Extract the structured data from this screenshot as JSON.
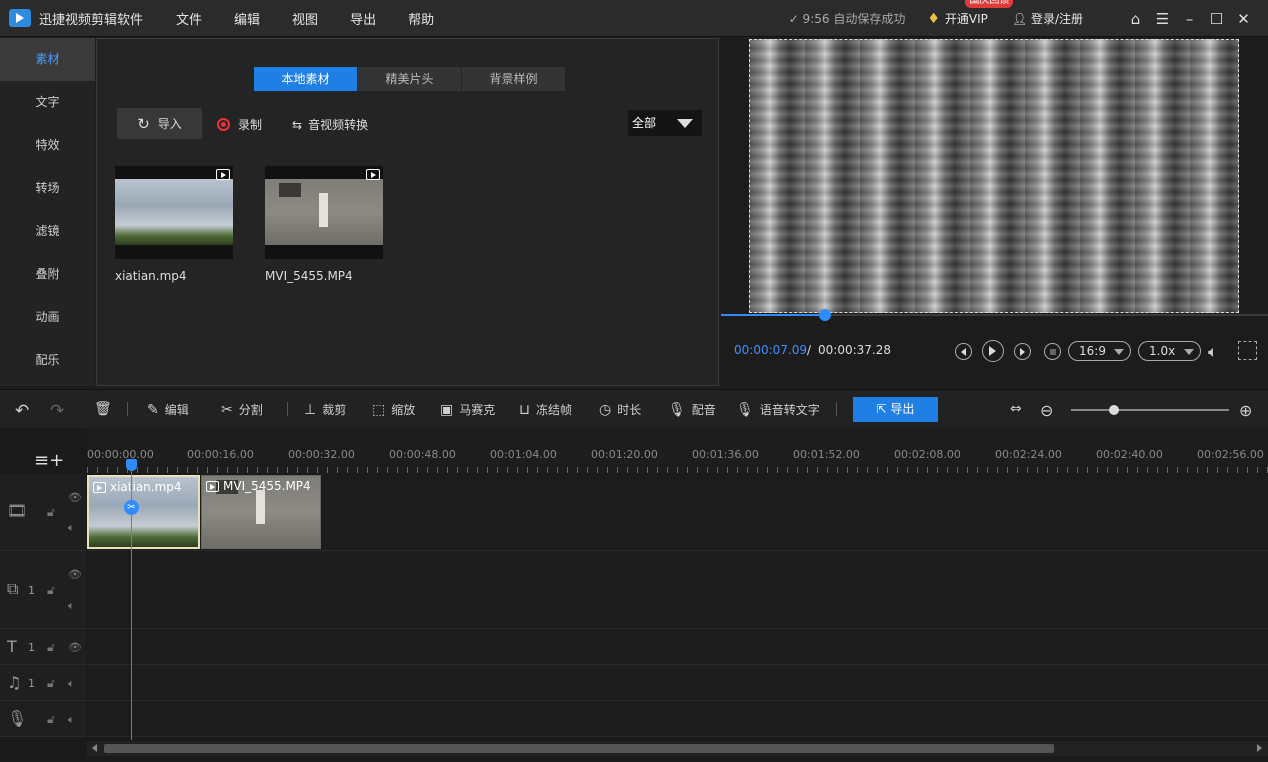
{
  "app": {
    "title": "迅捷视频剪辑软件"
  },
  "menu": [
    "文件",
    "编辑",
    "视图",
    "导出",
    "帮助"
  ],
  "titlebar": {
    "autosave": "✓ 9:56 自动保存成功",
    "vip_label": "开通VIP",
    "vip_badge": "国庆回馈",
    "login": "登录/注册"
  },
  "sidenav": [
    {
      "label": "素材",
      "active": true
    },
    {
      "label": "文字"
    },
    {
      "label": "特效"
    },
    {
      "label": "转场"
    },
    {
      "label": "滤镜"
    },
    {
      "label": "叠附"
    },
    {
      "label": "动画"
    },
    {
      "label": "配乐"
    }
  ],
  "library": {
    "tabs": [
      {
        "label": "本地素材",
        "active": true
      },
      {
        "label": "精美片头"
      },
      {
        "label": "背景样例"
      }
    ],
    "import_label": "导入",
    "record_label": "录制",
    "convert_label": "音视频转换",
    "filter_value": "全部",
    "items": [
      {
        "name": "xiatian.mp4"
      },
      {
        "name": "MVI_5455.MP4"
      }
    ]
  },
  "preview": {
    "current_time": "00:00:07.09",
    "separator": "/",
    "total_time": "00:00:37.28",
    "progress_fraction": 0.19,
    "aspect": "16:9",
    "speed": "1.0x"
  },
  "toolbar": {
    "edit": "编辑",
    "split": "分割",
    "crop": "裁剪",
    "scale": "缩放",
    "mosaic": "马赛克",
    "freeze": "冻结帧",
    "duration": "时长",
    "dub": "配音",
    "speech_to_text": "语音转文字",
    "export": "导出",
    "zoom_fraction": 0.27
  },
  "timeline": {
    "ruler": [
      "00:00:00.00",
      "00:00:16.00",
      "00:00:32.00",
      "00:00:48.00",
      "00:01:04.00",
      "00:01:20.00",
      "00:01:36.00",
      "00:01:52.00",
      "00:02:08.00",
      "00:02:24.00",
      "00:02:40.00",
      "00:02:56.00"
    ],
    "clips": [
      {
        "name": "xiatian.mp4"
      },
      {
        "name": "MVI_5455.MP4"
      }
    ],
    "track_numbers": {
      "overlay": "1",
      "text": "1",
      "music": "1"
    }
  },
  "colors": {
    "accent": "#1f7fe5",
    "playhead": "#2e8cff",
    "badge": "#e03a3a"
  }
}
